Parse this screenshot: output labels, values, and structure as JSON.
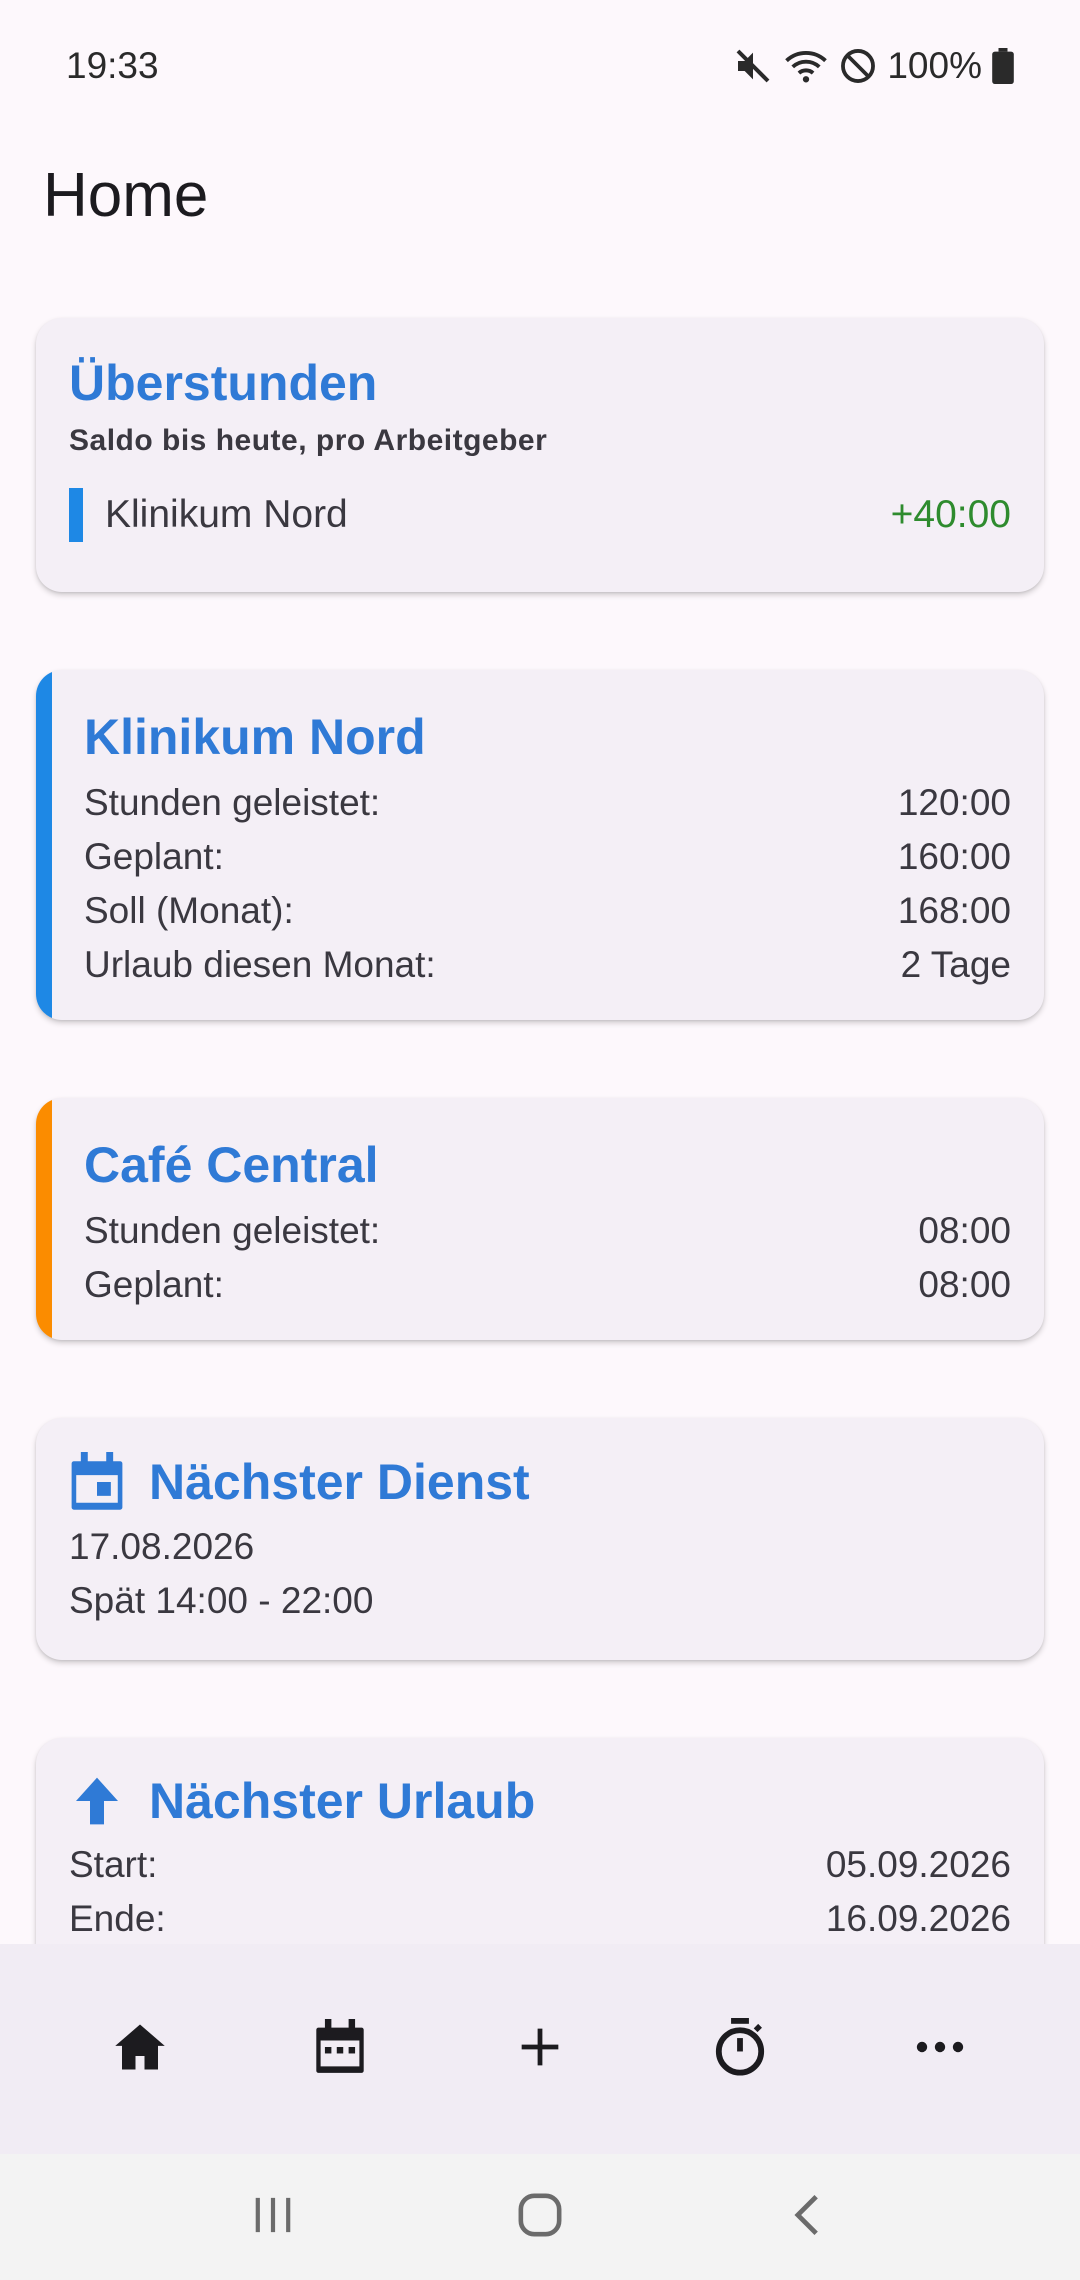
{
  "status": {
    "time": "19:33",
    "battery": "100%",
    "icons": [
      "mute-icon",
      "wifi-icon",
      "do-not-disturb-icon",
      "battery-icon"
    ]
  },
  "page": {
    "title": "Home"
  },
  "overtime": {
    "title": "Überstunden",
    "subtitle": "Saldo bis heute, pro Arbeitgeber",
    "items": [
      {
        "employer": "Klinikum Nord",
        "balance": "+40:00",
        "color": "#1e88e5",
        "balance_color": "#2e8b2e"
      }
    ]
  },
  "employers": [
    {
      "name": "Klinikum Nord",
      "color": "#1e88e5",
      "rows": [
        {
          "label": "Stunden geleistet:",
          "value": "120:00"
        },
        {
          "label": "Geplant:",
          "value": "160:00"
        },
        {
          "label": "Soll (Monat):",
          "value": "168:00"
        },
        {
          "label": "Urlaub diesen Monat:",
          "value": "2 Tage"
        }
      ]
    },
    {
      "name": "Café Central",
      "color": "#fb8c00",
      "rows": [
        {
          "label": "Stunden geleistet:",
          "value": "08:00"
        },
        {
          "label": "Geplant:",
          "value": "08:00"
        }
      ]
    }
  ],
  "next_shift": {
    "title": "Nächster Dienst",
    "icon": "calendar-icon",
    "date": "17.08.2026",
    "shift": "Spät 14:00 - 22:00"
  },
  "next_vacation": {
    "title": "Nächster Urlaub",
    "icon": "arrow-up-icon",
    "rows": [
      {
        "label": "Start:",
        "value": "05.09.2026"
      },
      {
        "label": "Ende:",
        "value": "16.09.2026"
      }
    ]
  },
  "bottom_nav": {
    "items": [
      "home-icon",
      "calendar-icon",
      "add-icon",
      "timer-icon",
      "more-icon"
    ]
  },
  "colors": {
    "accent": "#2f7ad6",
    "positive": "#2e8b2e",
    "card_bg": "#f4eff6"
  }
}
